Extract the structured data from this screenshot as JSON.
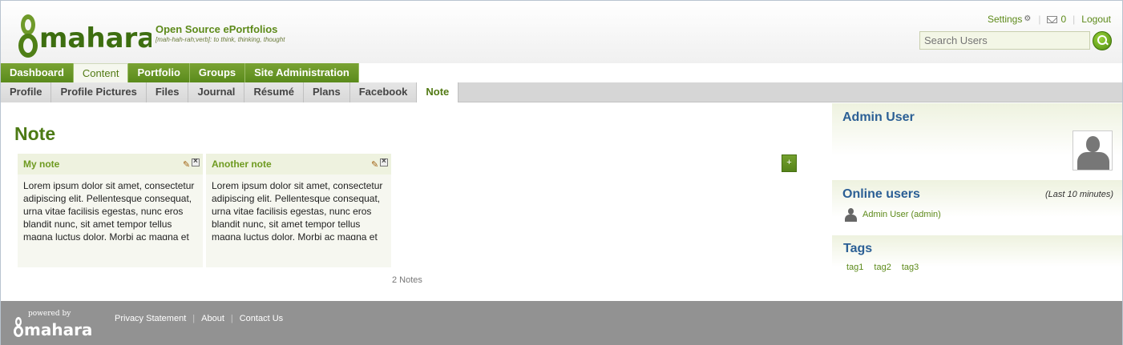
{
  "header": {
    "logo_text": "mahara",
    "tagline_title": "Open Source ePortfolios",
    "tagline_sub": "[mah-hah-rah;verb]: to think, thinking, thought",
    "links": {
      "settings": "Settings",
      "inbox_count": "0",
      "logout": "Logout"
    },
    "search": {
      "placeholder": "Search Users"
    }
  },
  "main_nav": [
    {
      "label": "Dashboard",
      "active": false
    },
    {
      "label": "Content",
      "active": true
    },
    {
      "label": "Portfolio",
      "active": false
    },
    {
      "label": "Groups",
      "active": false
    },
    {
      "label": "Site Administration",
      "active": false
    }
  ],
  "sub_nav": [
    {
      "label": "Profile",
      "active": false
    },
    {
      "label": "Profile Pictures",
      "active": false
    },
    {
      "label": "Files",
      "active": false
    },
    {
      "label": "Journal",
      "active": false
    },
    {
      "label": "Résumé",
      "active": false
    },
    {
      "label": "Plans",
      "active": false
    },
    {
      "label": "Facebook",
      "active": false
    },
    {
      "label": "Note",
      "active": true
    }
  ],
  "main": {
    "title": "Note",
    "add_label": "+",
    "notes": [
      {
        "title": "My note",
        "body": "Lorem ipsum dolor sit amet, consectetur adipiscing elit. Pellentesque consequat, urna vitae facilisis egestas, nunc eros blandit nunc, sit amet tempor tellus magna luctus dolor. Morbi ac magna et ligula hendrerit."
      },
      {
        "title": "Another note",
        "body": "Lorem ipsum dolor sit amet, consectetur adipiscing elit. Pellentesque consequat, urna vitae facilisis egestas, nunc eros blandit nunc, sit amet tempor tellus magna luctus dolor. Morbi ac magna et ligula hendrerit."
      }
    ],
    "count_text": "2 Notes"
  },
  "sidebar": {
    "profile": {
      "name": "Admin User"
    },
    "online": {
      "title": "Online users",
      "period": "(Last 10 minutes)",
      "users": [
        "Admin User (admin)"
      ]
    },
    "tags": {
      "title": "Tags",
      "items": [
        "tag1",
        "tag2",
        "tag3"
      ]
    }
  },
  "footer": {
    "powered_by": "powered by",
    "logo_text": "mahara",
    "links": [
      "Privacy Statement",
      "About",
      "Contact Us"
    ]
  },
  "colors": {
    "brand_green": "#5a8a1b",
    "heading_blue": "#2b5f95",
    "footer_gray": "#929292"
  }
}
